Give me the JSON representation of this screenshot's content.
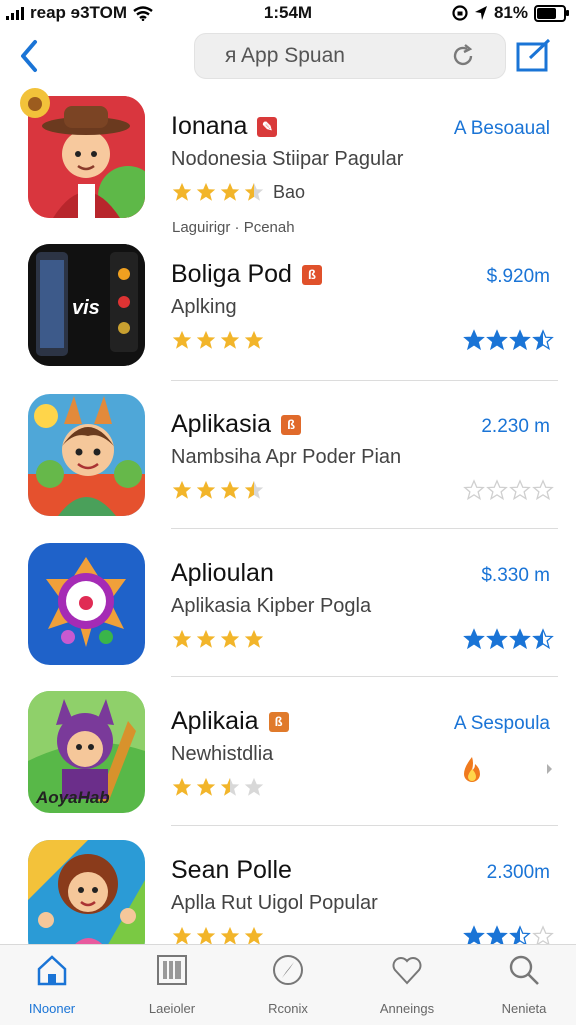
{
  "status_bar": {
    "carrier": "reap ɘ3TOM",
    "time": "1:54M",
    "battery": "81%",
    "battery_level": 0.81
  },
  "nav": {
    "search_text": "ᴙ App Spuan",
    "back_icon": "chevron-left-icon",
    "refresh_icon": "refresh-icon",
    "compose_icon": "compose-icon"
  },
  "apps": [
    {
      "title": "Ionana",
      "subtitle": "Nodonesia Stiipar Pagular",
      "rating_text": "Bao",
      "rating": 3.5,
      "price": "A Besoaual",
      "extra": "Laguirigr · Pcenah",
      "right_rating": null
    },
    {
      "title": "Boliga Pod",
      "subtitle": "Aplking",
      "rating": 4,
      "price": "$.920m",
      "right_rating": 3.5
    },
    {
      "title": "Aplikasia",
      "subtitle": "Nambsiha Apr Poder Pian",
      "rating": 3.5,
      "price": "2.230 m",
      "right_rating": 0
    },
    {
      "title": "Aplioulan",
      "subtitle": "Aplikasia Kipber Pogla",
      "rating": 4,
      "price": "$.330 m",
      "right_rating": 3.5
    },
    {
      "title": "Aplikaia",
      "subtitle": "Newhistdlia",
      "rating": 2.5,
      "price": "A Sespoula",
      "right_rating": null,
      "right_icon": "fire-icon"
    },
    {
      "title": "Sean Polle",
      "subtitle": "Aplla Rut Uigol Popular",
      "rating": 4,
      "price": "2.300m",
      "right_rating": 2.5
    }
  ],
  "tabs": [
    {
      "label": "INooner",
      "icon": "home-icon",
      "active": true
    },
    {
      "label": "Laeioler",
      "icon": "library-icon",
      "active": false
    },
    {
      "label": "Rconix",
      "icon": "compass-icon",
      "active": false
    },
    {
      "label": "Anneings",
      "icon": "heart-icon",
      "active": false
    },
    {
      "label": "Nenieta",
      "icon": "search-icon",
      "active": false
    }
  ],
  "colors": {
    "accent": "#1a74d6",
    "star_gold": "#f2b52a",
    "star_empty": "#d8d8d8",
    "tag": "#e0512b"
  }
}
